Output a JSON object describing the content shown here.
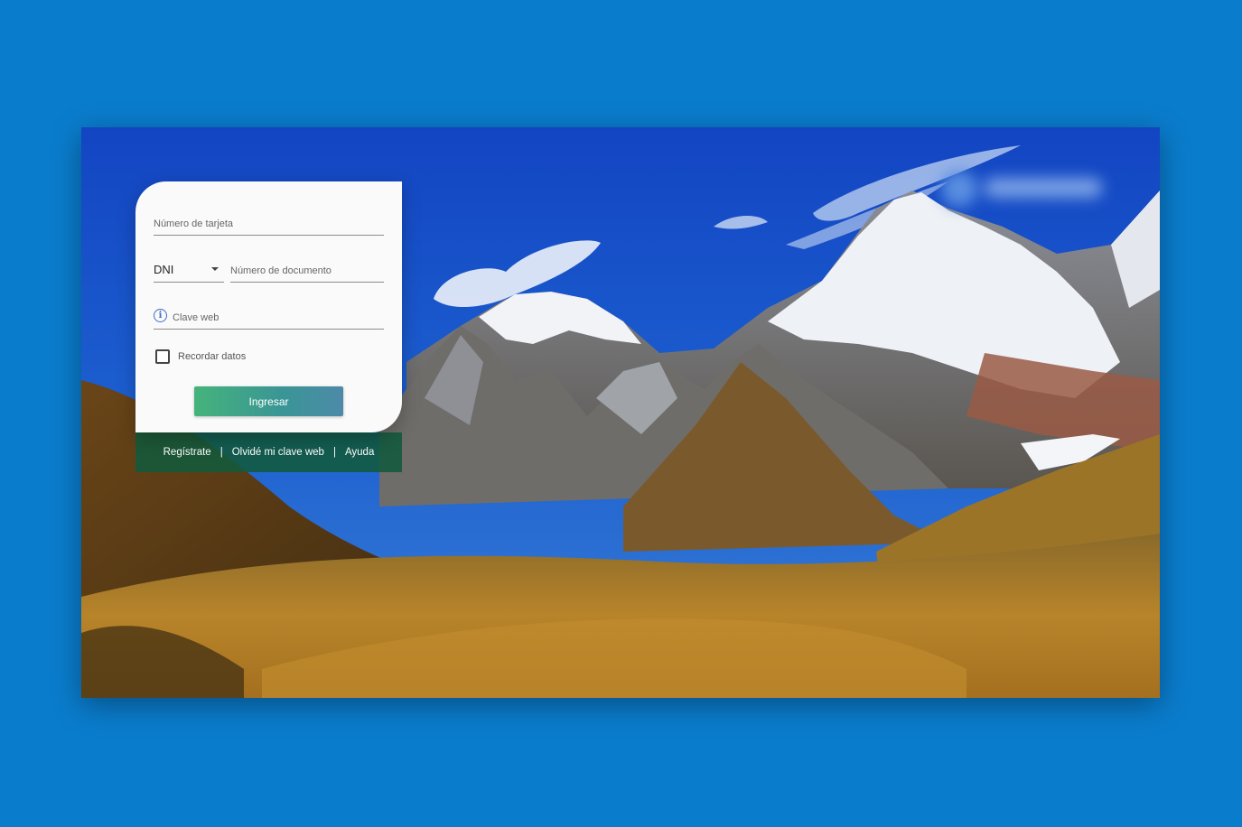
{
  "login": {
    "card_number_placeholder": "Número de tarjeta",
    "doc_type_value": "DNI",
    "doc_number_placeholder": "Número de documento",
    "password_placeholder": "Clave web",
    "remember_label": "Recordar datos",
    "remember_checked": false,
    "submit_label": "Ingresar"
  },
  "footer_links": {
    "register": "Regístrate",
    "forgot": "Olvidé mi clave web",
    "help": "Ayuda",
    "separator": "|"
  },
  "colors": {
    "page_background": "#0a7ccc",
    "button_gradient_start": "#45b37b",
    "button_gradient_end": "#4d8aa8",
    "links_bar": "#125a3c"
  },
  "background_image": "mountain-landscape"
}
